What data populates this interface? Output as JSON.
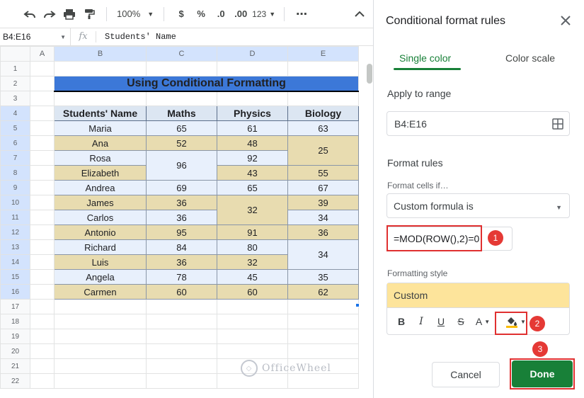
{
  "toolbar": {
    "zoom": "100%",
    "currency": "$",
    "percent": "%",
    "decrease_decimal": ".0",
    "increase_decimal": ".00",
    "number_format": "123",
    "more": "⋯"
  },
  "formula_bar": {
    "name_box": "B4:E16",
    "fx": "fx",
    "content": "Students' Name"
  },
  "sheet": {
    "columns": [
      "A",
      "B",
      "C",
      "D",
      "E"
    ],
    "rows": [
      "1",
      "2",
      "3",
      "4",
      "5",
      "6",
      "7",
      "8",
      "9",
      "10",
      "11",
      "12",
      "13",
      "14",
      "15",
      "16",
      "17",
      "18",
      "19",
      "20",
      "21",
      "22"
    ],
    "title": "Using Conditional Formatting",
    "headers": [
      "Students' Name",
      "Maths",
      "Physics",
      "Biology"
    ],
    "names": [
      "Maria",
      "Ana",
      "Rosa",
      "Elizabeth",
      "Andrea",
      "James",
      "Carlos",
      "Antonio",
      "Richard",
      "Luis",
      "Angela",
      "Carmen"
    ],
    "maths": [
      "65",
      "52",
      "96",
      "69",
      "36",
      "36",
      "95",
      "84",
      "36",
      "78",
      "60"
    ],
    "physics": [
      "61",
      "48",
      "92",
      "43",
      "65",
      "32",
      "91",
      "80",
      "32",
      "45",
      "60"
    ],
    "biology": [
      "63",
      "25",
      "55",
      "67",
      "39",
      "34",
      "36",
      "34",
      "35",
      "62"
    ]
  },
  "watermark": "OfficeWheel",
  "panel": {
    "title": "Conditional format rules",
    "tab_single": "Single color",
    "tab_scale": "Color scale",
    "apply_range_label": "Apply to range",
    "range_value": "B4:E16",
    "format_rules_label": "Format rules",
    "format_cells_if": "Format cells if…",
    "condition": "Custom formula is",
    "formula": "=MOD(ROW(),2)=0",
    "formatting_style_label": "Formatting style",
    "style_preview": "Custom",
    "style_tools": [
      "B",
      "I",
      "U",
      "S",
      "A"
    ],
    "cancel": "Cancel",
    "done": "Done",
    "badges": [
      "1",
      "2",
      "3"
    ]
  },
  "colors": {
    "title_fill": "#3c78d8",
    "even_row": "#e8dcb0",
    "odd_row": "#e8f0fc",
    "accent_green": "#188038",
    "highlight_red": "#e03030",
    "style_fill": "#fde49b"
  }
}
